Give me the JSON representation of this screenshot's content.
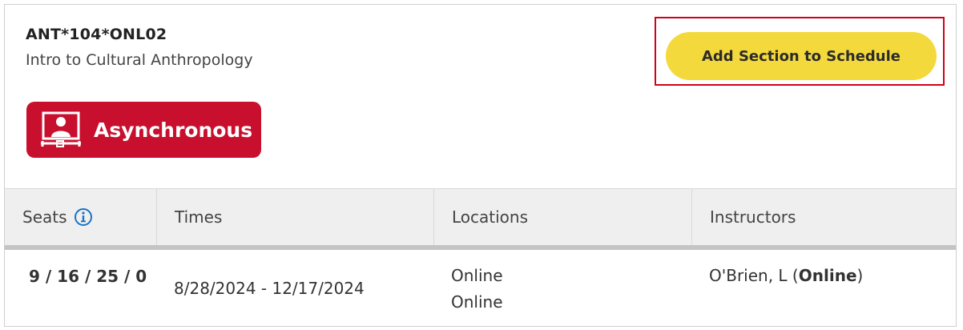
{
  "section": {
    "code": "ANT*104*ONL02",
    "title": "Intro to Cultural Anthropology",
    "badge_label": "Asynchronous",
    "add_button_label": "Add Section to Schedule"
  },
  "table": {
    "headers": {
      "seats": "Seats",
      "times": "Times",
      "locations": "Locations",
      "instructors": "Instructors"
    },
    "row": {
      "seats": "9 / 16 / 25 / 0",
      "times": "8/28/2024 - 12/17/2024",
      "locations": [
        "Online",
        "Online"
      ],
      "instructor_name": "O'Brien, L (",
      "instructor_method": "Online",
      "instructor_close": ")"
    }
  },
  "icons": {
    "badge_icon": "monitor-person-icon",
    "seats_info_icon": "info-circle-icon"
  },
  "colors": {
    "badge": "#c8102e",
    "button": "#f4d93c",
    "highlight_border": "#d0021b",
    "info_icon": "#1a73c8"
  }
}
